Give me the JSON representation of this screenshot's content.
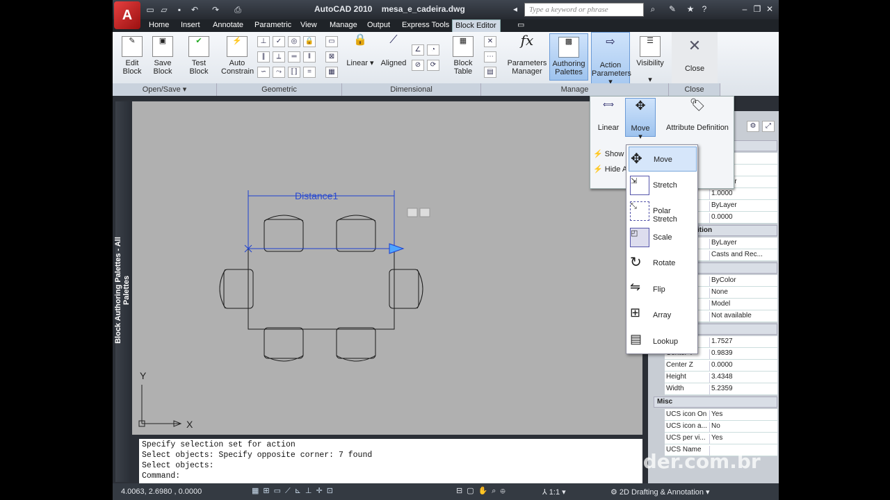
{
  "app": {
    "title": "AutoCAD 2010",
    "filename": "mesa_e_cadeira.dwg",
    "logo": "A"
  },
  "search": {
    "placeholder": "Type a keyword or phrase"
  },
  "tabs": [
    "Home",
    "Insert",
    "Annotate",
    "Parametric",
    "View",
    "Manage",
    "Output",
    "Express Tools",
    "Block Editor"
  ],
  "ribbon": {
    "open_save": {
      "title": "Open/Save",
      "buttons": [
        "Edit\nBlock",
        "Save\nBlock",
        "Test\nBlock"
      ]
    },
    "geometric": {
      "title": "Geometric",
      "auto": "Auto\nConstrain"
    },
    "dimensional": {
      "title": "Dimensional",
      "linear": "Linear",
      "aligned": "Aligned",
      "block_table": "Block\nTable"
    },
    "manage": {
      "title": "Manage",
      "params": "Parameters\nManager",
      "authoring": "Authoring\nPalettes",
      "action": "Action\nParameters",
      "visibility": "Visibility"
    },
    "close": {
      "title": "Close",
      "label": "Close"
    }
  },
  "flyout": {
    "linear": "Linear",
    "move": "Move",
    "attr": "Attribute Definition",
    "show": "Show",
    "hide": "Hide A"
  },
  "menu": [
    "Move",
    "Stretch",
    "Polar Stretch",
    "Scale",
    "Rotate",
    "Flip",
    "Array",
    "Lookup"
  ],
  "drawing": {
    "distance_label": "Distance1",
    "ucs_x": "X",
    "ucs_y": "Y"
  },
  "palette_bar": "Block Authoring Palettes - All Palettes",
  "command": [
    "Specify selection set for action",
    "Select objects: Specify opposite corner: 7 found",
    "Select objects:",
    "Command:"
  ],
  "status": {
    "coords": "4.0063, 2.6980 , 0.0000",
    "scale": "1:1",
    "workspace": "2D Drafting & Annotation"
  },
  "properties": {
    "rows1": [
      [
        "",
        "yer"
      ],
      [
        "",
        ""
      ],
      [
        "",
        "ByLayer"
      ],
      [
        "",
        "1.0000"
      ],
      [
        "",
        "ByLayer"
      ],
      [
        "",
        "0.0000"
      ]
    ],
    "sec2": "ition",
    "rows2": [
      [
        "",
        "ByLayer"
      ],
      [
        "",
        "Casts and Rec..."
      ]
    ],
    "rows3": [
      [
        "",
        "ByColor"
      ],
      [
        "",
        "None"
      ],
      [
        "",
        "Model"
      ],
      [
        "",
        "Not available"
      ]
    ],
    "rows4": [
      [
        "",
        "1.7527"
      ],
      [
        "Center Y",
        "0.9839"
      ],
      [
        "Center Z",
        "0.0000"
      ],
      [
        "Height",
        "3.4348"
      ],
      [
        "Width",
        "5.2359"
      ]
    ],
    "misc": "Misc",
    "rows5": [
      [
        "UCS icon On",
        "Yes"
      ],
      [
        "UCS icon a...",
        "No"
      ],
      [
        "UCS per vi...",
        "Yes"
      ],
      [
        "UCS Name",
        ""
      ]
    ]
  },
  "watermark": "render.com.br"
}
